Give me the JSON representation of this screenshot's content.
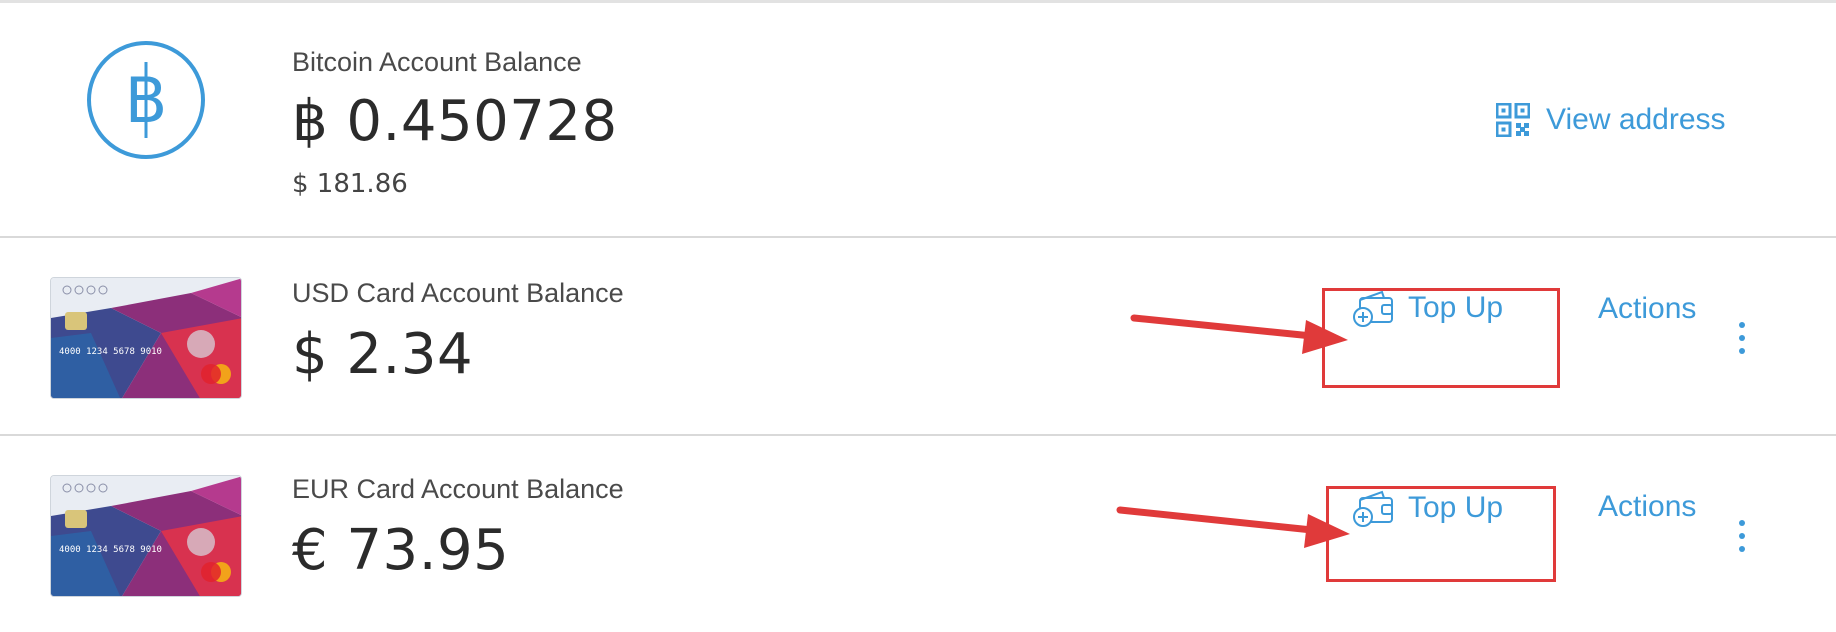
{
  "bitcoin": {
    "label": "Bitcoin Account Balance",
    "amount": "฿ 0.450728",
    "fiat_value": "$ 181.86",
    "view_address_label": "View address",
    "logo_symbol": "B"
  },
  "accounts": [
    {
      "label": "USD Card Account Balance",
      "amount": "$ 2.34",
      "topup_label": "Top Up",
      "actions_label": "Actions"
    },
    {
      "label": "EUR Card Account Balance",
      "amount": "€ 73.95",
      "topup_label": "Top Up",
      "actions_label": "Actions"
    }
  ],
  "card_image": {
    "number_text": "4000 1234 5678 9010",
    "brand": "MasterCard"
  },
  "colors": {
    "link": "#3d9ad9",
    "annotation": "#e03a3a",
    "text": "#2b2b2b",
    "divider": "#d9d9d9"
  },
  "icons": [
    "bitcoin-logo-icon",
    "qr-code-icon",
    "wallet-topup-icon",
    "kebab-menu-icon",
    "annotation-arrow-icon"
  ]
}
